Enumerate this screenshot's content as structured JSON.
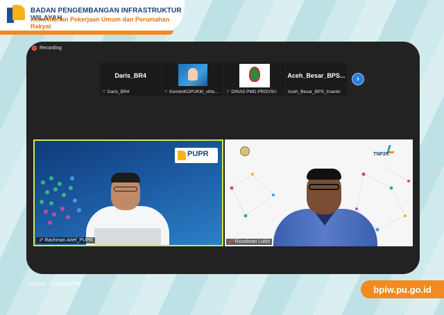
{
  "header": {
    "org_name": "BADAN PENGEMBANGAN INFRASTRUKTUR WILAYAH",
    "org_sub": "Kementerian Pekerjaan Umum dan Perumahan Rakyat"
  },
  "meeting": {
    "recording_label": "Recording",
    "thumbnails": [
      {
        "title": "Daris_BR4",
        "label": "Daris_BR4",
        "muted": true
      },
      {
        "title": "",
        "label": "KemenKOPUKM_siNo...",
        "muted": true
      },
      {
        "title": "",
        "label": "DINAS PMD PROVSU",
        "muted": true
      },
      {
        "title": "Aceh_Besar_BPS...",
        "label": "Aceh_Besar_BPS_Irnanto",
        "muted": false
      }
    ],
    "next_icon": "chevron-right-icon",
    "main_videos": [
      {
        "name": "Rachman Arief_PUPR",
        "logo_text": "PUPR",
        "active_speaker": true
      },
      {
        "name": "Rissalwan Lubis",
        "logo_text": "TNP2K",
        "active_speaker": false
      }
    ]
  },
  "footer": {
    "source": "Sumber : Kompu BPIW",
    "website": "bpiw.pu.go.id"
  },
  "colors": {
    "accent_orange": "#f18a21",
    "brand_blue": "#1b3f7a",
    "active_speaker_border": "#d7e650",
    "meeting_bg": "#222222"
  }
}
